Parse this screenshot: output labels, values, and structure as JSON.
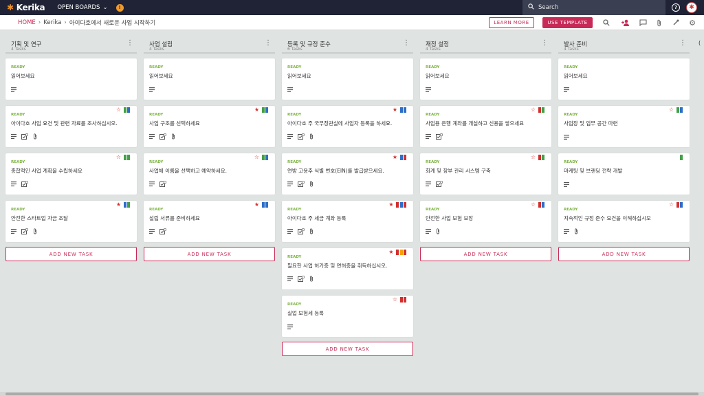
{
  "topbar": {
    "app_name": "Kerika",
    "open_boards": "OPEN BOARDS",
    "search_placeholder": "Search"
  },
  "breadcrumb": {
    "home": "HOME",
    "account": "Kerika",
    "board": "아이다호에서 새로운 사업 시작하기"
  },
  "actions": {
    "learn_more": "LEARN MORE",
    "use_template": "USE TEMPLATE"
  },
  "add_task_label": "ADD NEW TASK",
  "columns": [
    {
      "title": "기획 및 연구",
      "count": "4 Tasks",
      "cards": [
        {
          "status": "READY",
          "title": "읽어보세요",
          "star": "",
          "flags": [],
          "meta": [
            "desc"
          ]
        },
        {
          "status": "READY",
          "title": "아이다호 사업 요건 및 관련 자료를 조사하십시오.",
          "star": "outline",
          "flags": [
            "green",
            "blue"
          ],
          "meta": [
            "desc",
            "check",
            "clip"
          ]
        },
        {
          "status": "READY",
          "title": "종합적인 사업 계획을 수립하세요",
          "star": "outline",
          "flags": [
            "green",
            "green"
          ],
          "meta": [
            "desc",
            "check"
          ]
        },
        {
          "status": "READY",
          "title": "안전한 스타트업 자금 조달",
          "star": "filled",
          "flags": [
            "blue",
            "green"
          ],
          "meta": [
            "desc",
            "check",
            "clip"
          ]
        }
      ]
    },
    {
      "title": "사업 설립",
      "count": "4 Tasks",
      "cards": [
        {
          "status": "READY",
          "title": "읽어보세요",
          "star": "",
          "flags": [],
          "meta": [
            "desc"
          ]
        },
        {
          "status": "READY",
          "title": "사업 구조를 선택하세요",
          "star": "filled",
          "flags": [
            "green",
            "blue"
          ],
          "meta": [
            "desc",
            "check",
            "clip"
          ]
        },
        {
          "status": "READY",
          "title": "사업체 이름을 선택하고 예약하세요.",
          "star": "outline",
          "flags": [
            "green",
            "blue"
          ],
          "meta": [
            "desc",
            "check"
          ]
        },
        {
          "status": "READY",
          "title": "설립 서류를 준비하세요",
          "star": "filled",
          "flags": [
            "blue",
            "blue"
          ],
          "meta": [
            "desc",
            "check"
          ]
        }
      ]
    },
    {
      "title": "등록 및 규정 준수",
      "count": "6 Tasks",
      "cards": [
        {
          "status": "READY",
          "title": "읽어보세요",
          "star": "",
          "flags": [],
          "meta": [
            "desc"
          ]
        },
        {
          "status": "READY",
          "title": "아이다호 주 국무장관실에 사업자 등록을 하세요.",
          "star": "filled",
          "flags": [
            "blue",
            "blue"
          ],
          "meta": [
            "desc",
            "check",
            "clip"
          ]
        },
        {
          "status": "READY",
          "title": "연방 고용주 식별 번호(EIN)를 발급받으세요.",
          "star": "filled",
          "flags": [
            "blue",
            "red"
          ],
          "meta": [
            "desc",
            "check",
            "clip"
          ]
        },
        {
          "status": "READY",
          "title": "아이다호 주 세금 계좌 등록",
          "star": "filled",
          "flags": [
            "red",
            "blue",
            "red"
          ],
          "meta": [
            "desc",
            "check",
            "clip"
          ]
        },
        {
          "status": "READY",
          "title": "필요한 사업 허가증 및 면허증을 취득하십시오.",
          "star": "filled",
          "flags": [
            "red",
            "orange",
            "red"
          ],
          "meta": [
            "desc",
            "check",
            "clip"
          ]
        },
        {
          "status": "READY",
          "title": "실업 보험세 등록",
          "star": "outline",
          "flags": [
            "red",
            "red"
          ],
          "meta": [
            "desc"
          ]
        }
      ]
    },
    {
      "title": "재정 설정",
      "count": "4 Tasks",
      "cards": [
        {
          "status": "READY",
          "title": "읽어보세요",
          "star": "",
          "flags": [],
          "meta": [
            "desc"
          ]
        },
        {
          "status": "READY",
          "title": "사업용 은행 계좌를 개설하고 신용을 쌓으세요",
          "star": "outline",
          "flags": [
            "red",
            "green"
          ],
          "meta": [
            "desc",
            "check"
          ]
        },
        {
          "status": "READY",
          "title": "회계 및 장부 관리 시스템 구축",
          "star": "outline",
          "flags": [
            "red",
            "green"
          ],
          "meta": [
            "desc",
            "check"
          ]
        },
        {
          "status": "READY",
          "title": "안전한 사업 보험 보장",
          "star": "outline",
          "flags": [
            "red",
            "blue"
          ],
          "meta": [
            "desc",
            "clip"
          ]
        }
      ]
    },
    {
      "title": "발사 준비",
      "count": "4 Tasks",
      "cards": [
        {
          "status": "READY",
          "title": "읽어보세요",
          "star": "",
          "flags": [],
          "meta": [
            "desc"
          ]
        },
        {
          "status": "READY",
          "title": "사업장 및 업무 공간 마련",
          "star": "outline",
          "flags": [
            "green",
            "blue"
          ],
          "meta": [
            "desc"
          ]
        },
        {
          "status": "READY",
          "title": "마케팅 및 브랜딩 전략 개발",
          "star": "",
          "flags": [
            "green"
          ],
          "meta": [
            "desc"
          ]
        },
        {
          "status": "READY",
          "title": "지속적인 규정 준수 요건을 이해하십시오",
          "star": "outline",
          "flags": [
            "red",
            "blue"
          ],
          "meta": [
            "desc",
            "clip"
          ]
        }
      ]
    }
  ]
}
